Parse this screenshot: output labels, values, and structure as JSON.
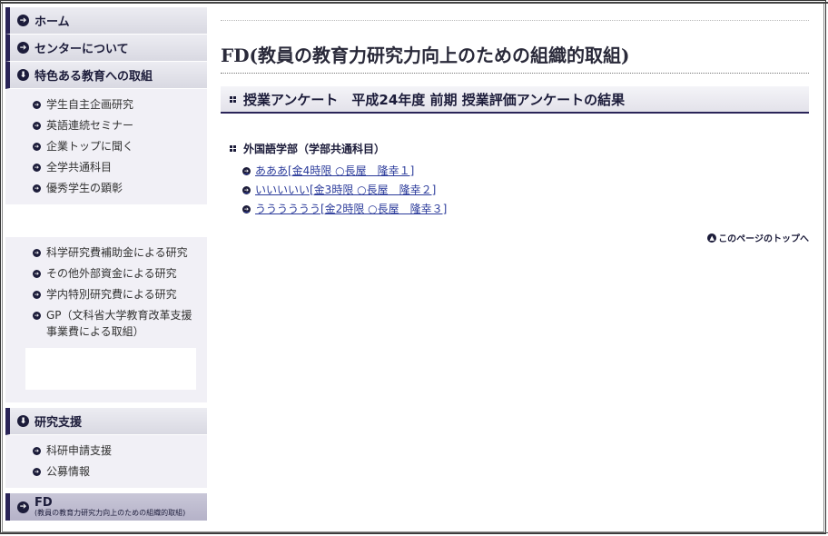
{
  "sidebar": {
    "home": "ホーム",
    "about": "センターについて",
    "special": "特色ある教育への取組",
    "special_items": [
      "学生自主企画研究",
      "英語連続セミナー",
      "企業トップに聞く",
      "全学共通科目",
      "優秀学生の顕彰"
    ],
    "research_items": [
      "科学研究費補助金による研究",
      "その他外部資金による研究",
      "学内特別研究費による研究",
      "GP（文科省大学教育改革支援事業費による取組）"
    ],
    "support": "研究支援",
    "support_items": [
      "科研申請支援",
      "公募情報"
    ],
    "fd_title": "FD",
    "fd_sub": "(教員の教育力研究力向上のための組織的取組)"
  },
  "main": {
    "page_title": "FD(教員の教育力研究力向上のための組織的取組)",
    "section_title": "授業アンケート　平成24年度 前期 授業評価アンケートの結果",
    "department": "外国語学部（学部共通科目）",
    "links": [
      "あああ[金4時限 ○長屋　隆幸１]",
      "いいいいい[金3時限 ○長屋　隆幸２]",
      "うううううう[金2時限 ○長屋　隆幸３]"
    ],
    "to_top": "このページのトップへ"
  }
}
